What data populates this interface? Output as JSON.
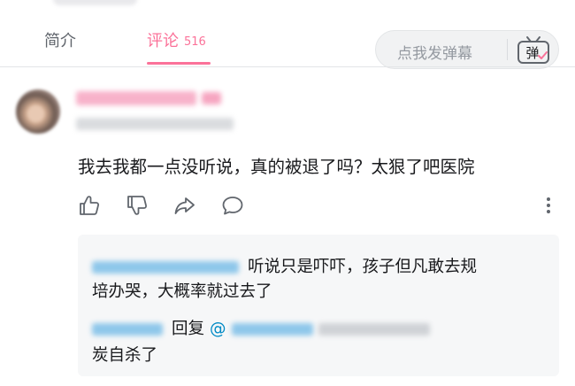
{
  "tabs": {
    "intro_label": "简介",
    "comments_label": "评论",
    "comments_count": "516"
  },
  "danmaku": {
    "placeholder": "点我发弹幕",
    "button_label": "弹"
  },
  "comment": {
    "text": "我去我都一点没听说，真的被退了吗？太狠了吧医院"
  },
  "replies": {
    "reply1_line1": "听说只是吓吓，孩子但凡敢去规",
    "reply1_line2": "培办哭，大概率就过去了",
    "reply2_word": "回复",
    "reply2_at": "@",
    "reply2_line2": "炭自杀了"
  },
  "colors": {
    "accent": "#fb7299",
    "link": "#008ac5"
  },
  "icons": [
    "thumbs-up-icon",
    "thumbs-down-icon",
    "share-icon",
    "reply-bubble-icon",
    "more-vertical-icon",
    "danmaku-tv-icon"
  ]
}
